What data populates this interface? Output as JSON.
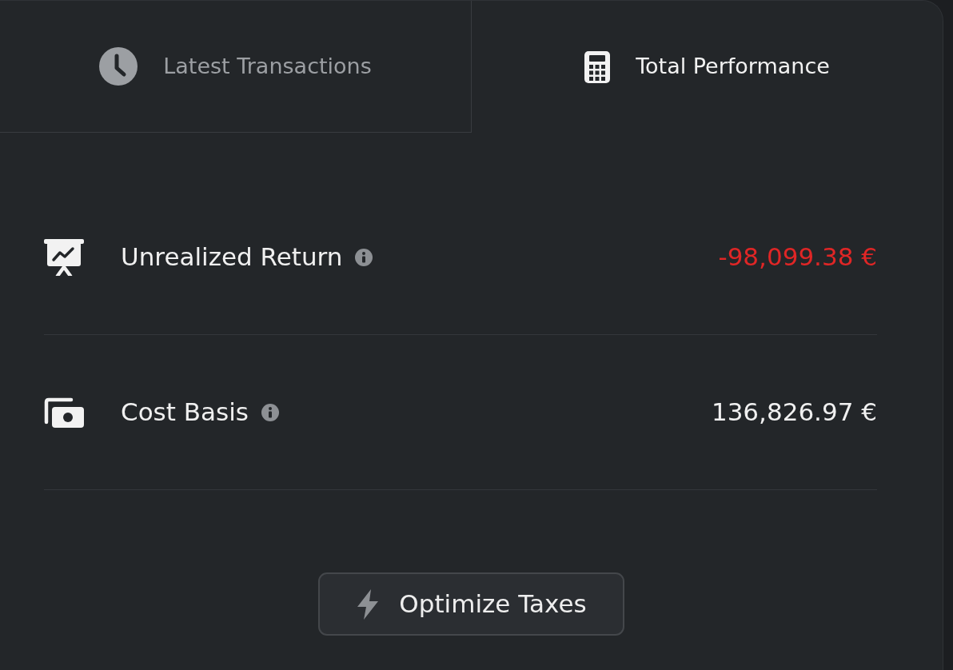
{
  "tabs": [
    {
      "label": "Latest Transactions",
      "selected": false
    },
    {
      "label": "Total Performance",
      "selected": true
    }
  ],
  "metrics": [
    {
      "label": "Unrealized Return",
      "value": "-98,099.38 €",
      "negative": true
    },
    {
      "label": "Cost Basis",
      "value": "136,826.97 €",
      "negative": false
    }
  ],
  "button": {
    "label": "Optimize Taxes"
  }
}
